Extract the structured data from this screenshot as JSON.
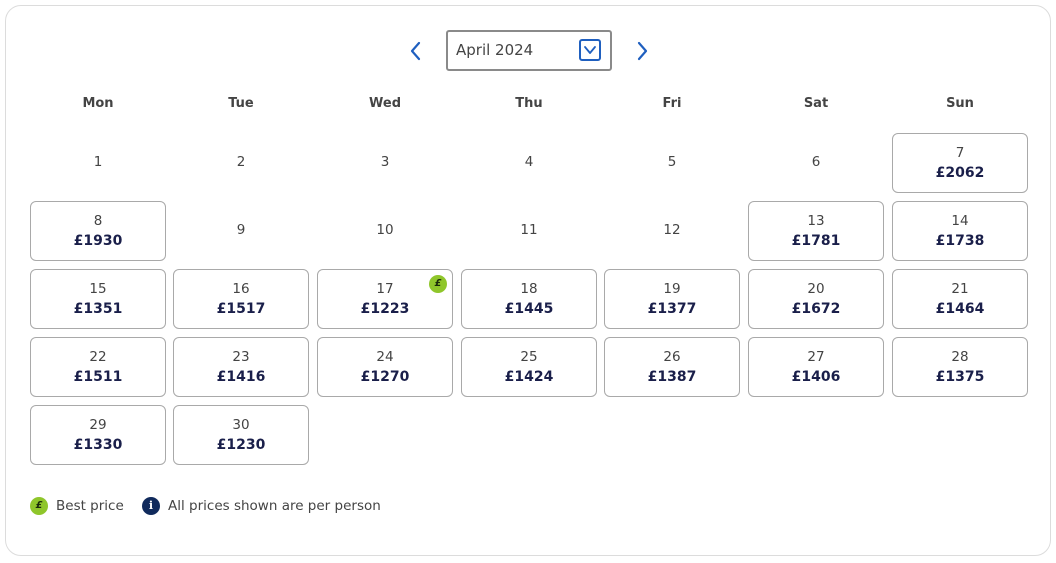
{
  "calendar": {
    "month_value": "April 2024",
    "weekdays": [
      "Mon",
      "Tue",
      "Wed",
      "Thu",
      "Fri",
      "Sat",
      "Sun"
    ],
    "days": [
      {
        "day": "1",
        "price": null
      },
      {
        "day": "2",
        "price": null
      },
      {
        "day": "3",
        "price": null
      },
      {
        "day": "4",
        "price": null
      },
      {
        "day": "5",
        "price": null
      },
      {
        "day": "6",
        "price": null
      },
      {
        "day": "7",
        "price": "£2062"
      },
      {
        "day": "8",
        "price": "£1930"
      },
      {
        "day": "9",
        "price": null
      },
      {
        "day": "10",
        "price": null
      },
      {
        "day": "11",
        "price": null
      },
      {
        "day": "12",
        "price": null
      },
      {
        "day": "13",
        "price": "£1781"
      },
      {
        "day": "14",
        "price": "£1738"
      },
      {
        "day": "15",
        "price": "£1351"
      },
      {
        "day": "16",
        "price": "£1517"
      },
      {
        "day": "17",
        "price": "£1223",
        "best": true
      },
      {
        "day": "18",
        "price": "£1445"
      },
      {
        "day": "19",
        "price": "£1377"
      },
      {
        "day": "20",
        "price": "£1672"
      },
      {
        "day": "21",
        "price": "£1464"
      },
      {
        "day": "22",
        "price": "£1511"
      },
      {
        "day": "23",
        "price": "£1416"
      },
      {
        "day": "24",
        "price": "£1270"
      },
      {
        "day": "25",
        "price": "£1424"
      },
      {
        "day": "26",
        "price": "£1387"
      },
      {
        "day": "27",
        "price": "£1406"
      },
      {
        "day": "28",
        "price": "£1375"
      },
      {
        "day": "29",
        "price": "£1330"
      },
      {
        "day": "30",
        "price": "£1230"
      }
    ],
    "best_badge_symbol": "£"
  },
  "legend": {
    "best_symbol": "£",
    "best_label": "Best price",
    "info_symbol": "i",
    "info_label": "All prices shown are per person"
  },
  "icons": {
    "prev": "chevron-left-icon",
    "next": "chevron-right-icon",
    "dropdown": "chevron-down-icon"
  },
  "colors": {
    "accent": "#1f5fbf",
    "best_price": "#8fc62b",
    "price_text": "#1a1f4a",
    "info_icon": "#102a5c"
  }
}
